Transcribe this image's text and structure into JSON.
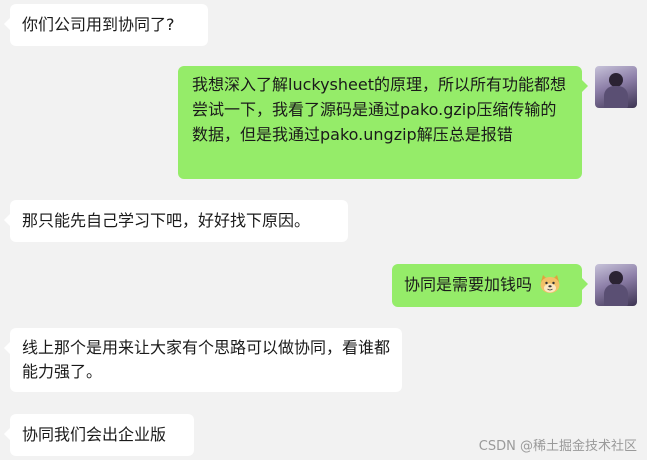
{
  "messages": [
    {
      "side": "left",
      "text": "你们公司用到协同了?"
    },
    {
      "side": "right",
      "text": "我想深入了解luckysheet的原理，所以所有功能都想尝试一下，我看了源码是通过pako.gzip压缩传输的数据，但是我通过pako.ungzip解压总是报错"
    },
    {
      "side": "left",
      "text": "那只能先自己学习下吧，好好找下原因。"
    },
    {
      "side": "right",
      "text": "协同是需要加钱吗",
      "emoji": "dog-face-emoji"
    },
    {
      "side": "left",
      "text": "线上那个是用来让大家有个思路可以做协同，看谁都能力强了。"
    },
    {
      "side": "left",
      "text": "协同我们会出企业版"
    }
  ],
  "watermark": "CSDN @稀土掘金技术社区",
  "colors": {
    "background": "#f2f2f2",
    "incoming_bubble": "#ffffff",
    "outgoing_bubble": "#95ec69"
  }
}
